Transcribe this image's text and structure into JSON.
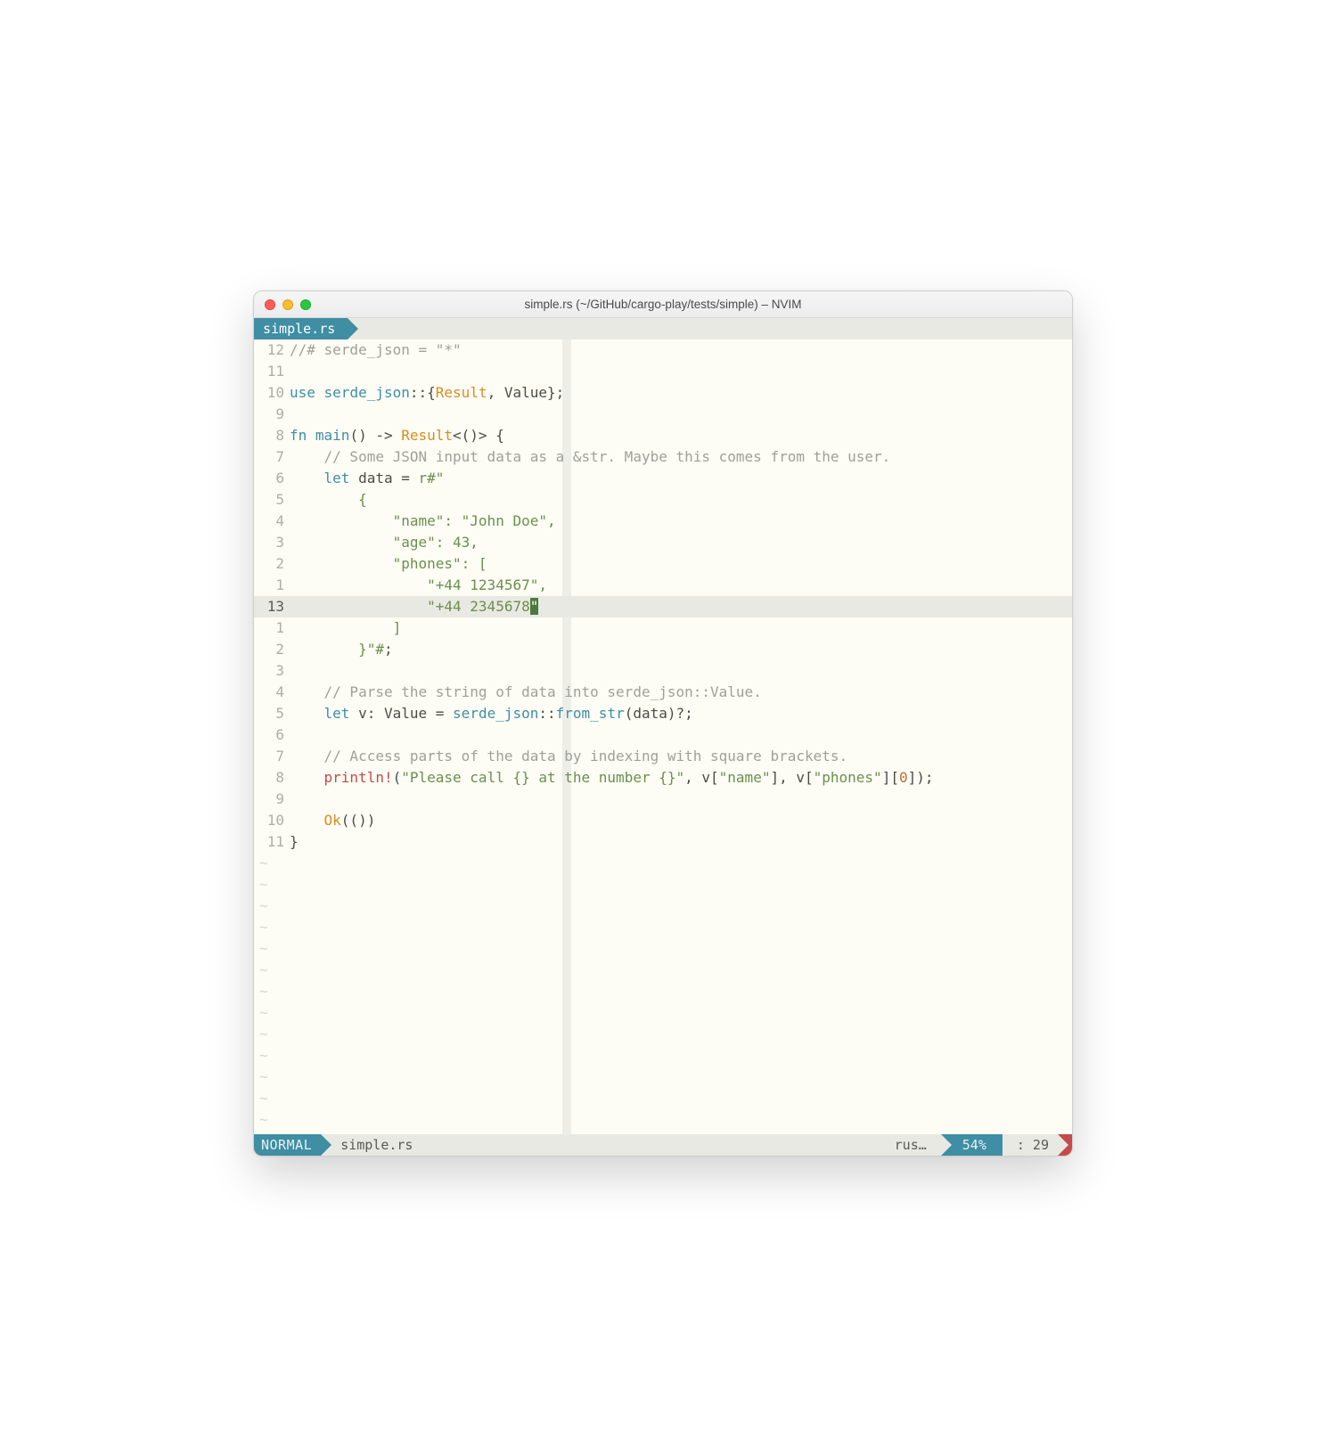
{
  "window": {
    "title": "simple.rs (~/GitHub/cargo-play/tests/simple) – NVIM"
  },
  "tab": {
    "label": "simple.rs"
  },
  "gutters": [
    "12",
    "11",
    "10",
    "9",
    "8",
    "7",
    "6",
    "5",
    "4",
    "3",
    "2",
    "1",
    "13",
    "1",
    "2",
    "3",
    "4",
    "5",
    "6",
    "7",
    "8",
    "9",
    "10",
    "11"
  ],
  "code": {
    "l0_a": "//# serde_json = \"*\"",
    "l1": "",
    "l2_use": "use",
    "l2_crate": " serde_json",
    "l2_sep": "::{",
    "l2_res": "Result",
    "l2_mid": ", ",
    "l2_val": "Value",
    "l2_end": "};",
    "l3": "",
    "l4_fn": "fn",
    "l4_main": " main",
    "l4_par": "() -> ",
    "l4_res": "Result",
    "l4_end": "<()> {",
    "l5": "    // Some JSON input data as a &str. Maybe this comes from the user.",
    "l6_let": "    let",
    "l6_data": " data ",
    "l6_eq": "= ",
    "l6_raw": "r#\"",
    "l7": "        {",
    "l8": "            \"name\": \"John Doe\",",
    "l9": "            \"age\": 43,",
    "l10": "            \"phones\": [",
    "l11": "                \"+44 1234567\",",
    "l12_a": "                \"+44 2345678",
    "l12_cur": "\"",
    "l13": "            ]",
    "l14": "        }\"#",
    "l14_semi": ";",
    "l15": "",
    "l16": "    // Parse the string of data into serde_json::Value.",
    "l17_let": "    let",
    "l17_v": " v: ",
    "l17_val": "Value",
    "l17_eq": " = ",
    "l17_crate": "serde_json",
    "l17_cc": "::",
    "l17_fn": "from_str",
    "l17_args": "(data)?;",
    "l18": "",
    "l19": "    // Access parts of the data by indexing with square brackets.",
    "l20_mac": "    println!",
    "l20_open": "(",
    "l20_str": "\"Please call {} at the number {}\"",
    "l20_mid1": ", v[",
    "l20_k1": "\"name\"",
    "l20_mid2": "], v[",
    "l20_k2": "\"phones\"",
    "l20_close": "][",
    "l20_idx": "0",
    "l20_end": "]);",
    "l21": "",
    "l22_ok": "    Ok",
    "l22_args": "(())",
    "l23": "}"
  },
  "tilde": "~",
  "status": {
    "mode": "NORMAL",
    "file": "simple.rs",
    "ft": "rus…",
    "pct": "54%",
    "pos": ": 29"
  }
}
